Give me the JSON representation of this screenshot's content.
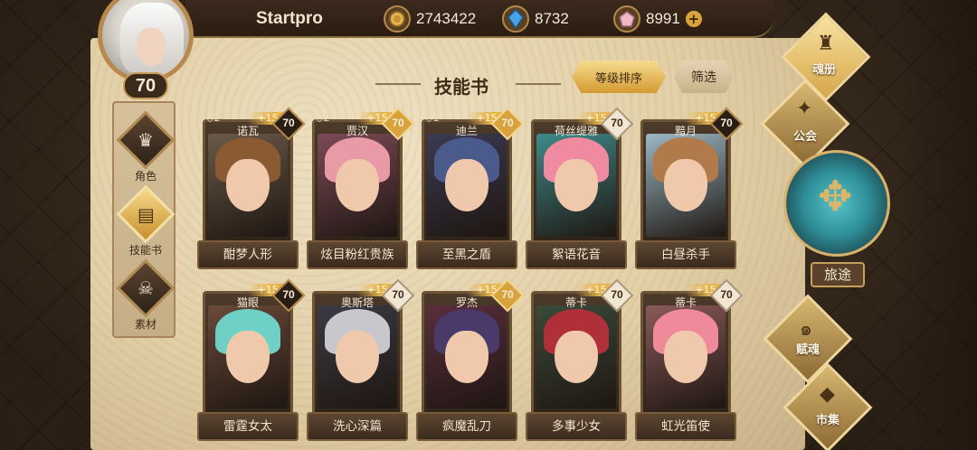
{
  "header": {
    "player_name": "Startpro",
    "level": "70",
    "gold": "2743422",
    "crystal": "8732",
    "gem": "8991",
    "plus": "+"
  },
  "left_nav": [
    {
      "label": "角色",
      "icon": "helmet-icon",
      "active": false
    },
    {
      "label": "技能书",
      "icon": "book-icon",
      "active": true
    },
    {
      "label": "素材",
      "icon": "skull-icon",
      "active": false
    }
  ],
  "page": {
    "title": "技能书",
    "sort_label": "等级排序",
    "filter_label": "筛选"
  },
  "cards": [
    {
      "hero": "诺瓦",
      "skill": "酣梦人形",
      "stars": "◇2",
      "bonus": "+15",
      "level": "70",
      "lv_style": "dark",
      "hair": "#8a5a32",
      "bg": "#6b5a48"
    },
    {
      "hero": "贾汉",
      "skill": "炫目粉红贵族",
      "stars": "◇2",
      "bonus": "+15",
      "level": "70",
      "lv_style": "gold",
      "hair": "#e89aa6",
      "bg": "#7d4a58"
    },
    {
      "hero": "迪兰",
      "skill": "至黑之盾",
      "stars": "◇1",
      "bonus": "+15",
      "level": "70",
      "lv_style": "gold",
      "hair": "#4a5a8a",
      "bg": "#3c3a52"
    },
    {
      "hero": "荷丝缇雅",
      "skill": "絮语花音",
      "stars": "",
      "bonus": "+15",
      "level": "70",
      "lv_style": "light",
      "hair": "#f08aa0",
      "bg": "#3f8a8a"
    },
    {
      "hero": "黯月",
      "skill": "白昼杀手",
      "stars": "",
      "bonus": "+15",
      "level": "70",
      "lv_style": "dark",
      "hair": "#b07a4a",
      "bg": "#9cb8c4"
    },
    {
      "hero": "猫眼",
      "skill": "雷霆女太",
      "stars": "",
      "bonus": "+15",
      "level": "70",
      "lv_style": "dark",
      "hair": "#6fd0c6",
      "bg": "#6a4a3a"
    },
    {
      "hero": "奥斯塔",
      "skill": "洗心深篇",
      "stars": "",
      "bonus": "+15",
      "level": "70",
      "lv_style": "light",
      "hair": "#c8c8cc",
      "bg": "#3c3a44"
    },
    {
      "hero": "罗杰",
      "skill": "疯魔乱刀",
      "stars": "",
      "bonus": "+15",
      "level": "70",
      "lv_style": "gold",
      "hair": "#4a3a6a",
      "bg": "#5a2e3e"
    },
    {
      "hero": "蒂卡",
      "skill": "多事少女",
      "stars": "",
      "bonus": "+15",
      "level": "70",
      "lv_style": "light",
      "hair": "#b0303a",
      "bg": "#3a4a3a"
    },
    {
      "hero": "蒂卡",
      "skill": "虹光笛使",
      "stars": "",
      "bonus": "+15",
      "level": "70",
      "lv_style": "light",
      "hair": "#ee8a9a",
      "bg": "#8a5a5a"
    }
  ],
  "right_nav": {
    "soul_book": "魂册",
    "guild": "公会",
    "journey": "旅途",
    "soul_bestow": "赋魂",
    "market": "市集"
  }
}
